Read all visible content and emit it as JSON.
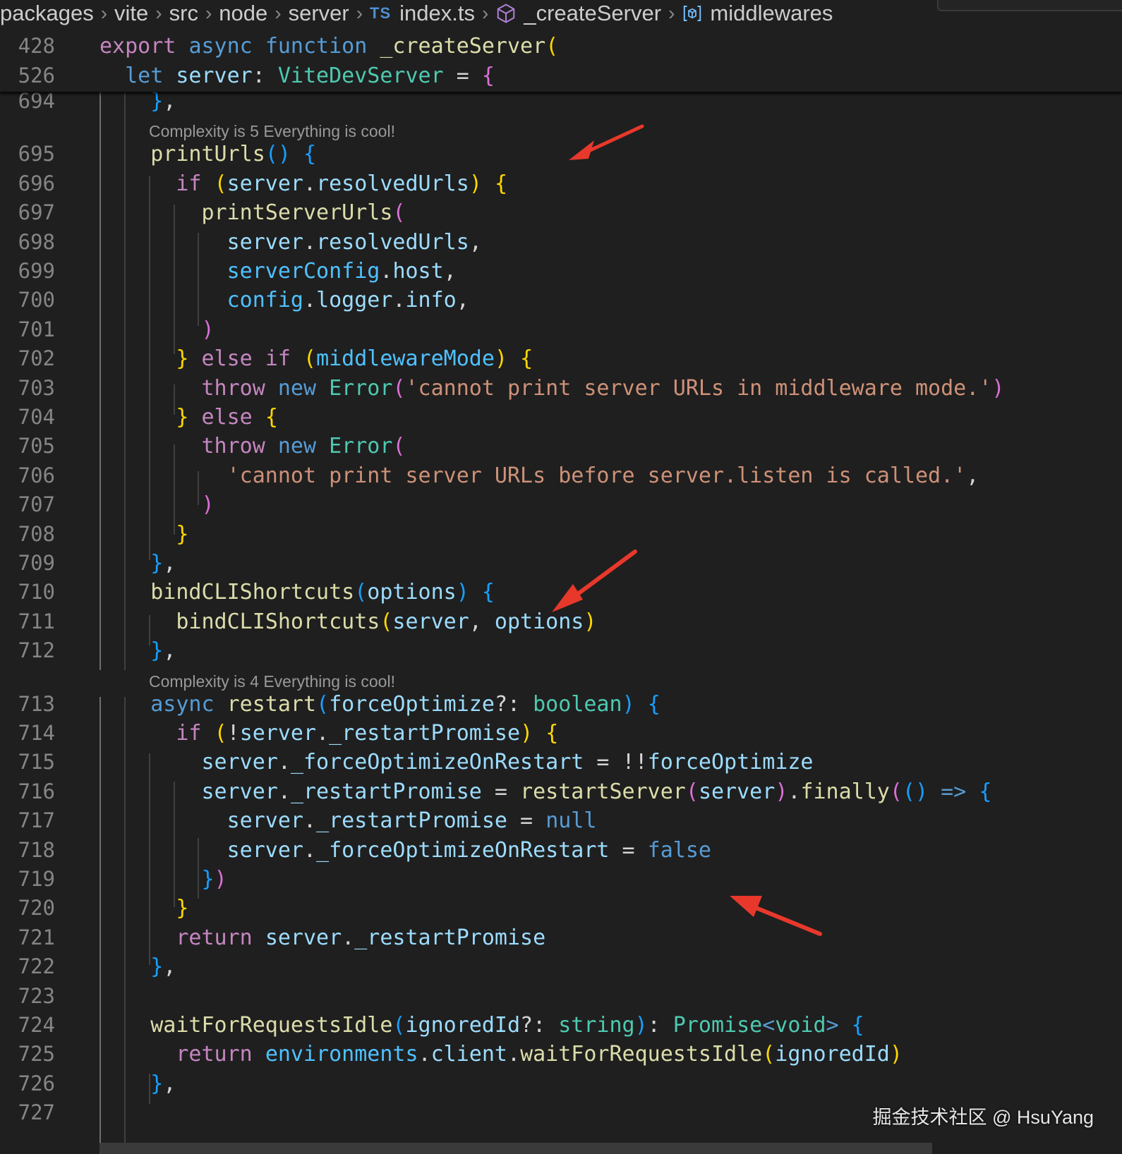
{
  "breadcrumb": [
    {
      "label": "packages",
      "icon": ""
    },
    {
      "label": "vite",
      "icon": ""
    },
    {
      "label": "src",
      "icon": ""
    },
    {
      "label": "node",
      "icon": ""
    },
    {
      "label": "server",
      "icon": ""
    },
    {
      "label": "index.ts",
      "icon": "typescript-file-icon",
      "badge": "TS"
    },
    {
      "label": "_createServer",
      "icon": "symbol-method-icon"
    },
    {
      "label": "middlewares",
      "icon": "symbol-variable-icon"
    }
  ],
  "sticky_lines": [
    {
      "n": "428",
      "t": [
        [
          "export",
          "ctl"
        ],
        [
          " ",
          "pl"
        ],
        [
          "async",
          "kw"
        ],
        [
          " ",
          "pl"
        ],
        [
          "function",
          "kw"
        ],
        [
          " ",
          "pl"
        ],
        [
          "_createServer",
          "fn"
        ],
        [
          "(",
          "b1"
        ]
      ]
    },
    {
      "n": "526",
      "t": [
        [
          "  ",
          "pl"
        ],
        [
          "let",
          "kw"
        ],
        [
          " ",
          "pl"
        ],
        [
          "server",
          "var"
        ],
        [
          ": ",
          "pl"
        ],
        [
          "ViteDevServer",
          "ty"
        ],
        [
          " = ",
          "pl"
        ],
        [
          "{",
          "b2"
        ]
      ]
    }
  ],
  "code_lines": [
    {
      "n": "694",
      "t": [
        [
          "    ",
          "pl"
        ],
        [
          "}",
          "b3"
        ],
        [
          ",",
          "pl"
        ]
      ]
    },
    {
      "lens": "Complexity is 5 Everything is cool!"
    },
    {
      "n": "695",
      "t": [
        [
          "    ",
          "pl"
        ],
        [
          "printUrls",
          "fn"
        ],
        [
          "()",
          "b3"
        ],
        [
          " ",
          "pl"
        ],
        [
          "{",
          "b3"
        ]
      ]
    },
    {
      "n": "696",
      "t": [
        [
          "      ",
          "pl"
        ],
        [
          "if",
          "ctl"
        ],
        [
          " ",
          "pl"
        ],
        [
          "(",
          "b1"
        ],
        [
          "server",
          "var"
        ],
        [
          ".",
          "pl"
        ],
        [
          "resolvedUrls",
          "var"
        ],
        [
          ")",
          "b1"
        ],
        [
          " ",
          "pl"
        ],
        [
          "{",
          "b1"
        ]
      ]
    },
    {
      "n": "697",
      "t": [
        [
          "        ",
          "pl"
        ],
        [
          "printServerUrls",
          "fn"
        ],
        [
          "(",
          "b2"
        ]
      ]
    },
    {
      "n": "698",
      "t": [
        [
          "          ",
          "pl"
        ],
        [
          "server",
          "var"
        ],
        [
          ".",
          "pl"
        ],
        [
          "resolvedUrls",
          "var"
        ],
        [
          ",",
          "pl"
        ]
      ]
    },
    {
      "n": "699",
      "t": [
        [
          "          ",
          "pl"
        ],
        [
          "serverConfig",
          "cst"
        ],
        [
          ".",
          "pl"
        ],
        [
          "host",
          "var"
        ],
        [
          ",",
          "pl"
        ]
      ]
    },
    {
      "n": "700",
      "t": [
        [
          "          ",
          "pl"
        ],
        [
          "config",
          "cst"
        ],
        [
          ".",
          "pl"
        ],
        [
          "logger",
          "var"
        ],
        [
          ".",
          "pl"
        ],
        [
          "info",
          "var"
        ],
        [
          ",",
          "pl"
        ]
      ]
    },
    {
      "n": "701",
      "t": [
        [
          "        ",
          "pl"
        ],
        [
          ")",
          "b2"
        ]
      ]
    },
    {
      "n": "702",
      "t": [
        [
          "      ",
          "pl"
        ],
        [
          "}",
          "b1"
        ],
        [
          " ",
          "pl"
        ],
        [
          "else",
          "ctl"
        ],
        [
          " ",
          "pl"
        ],
        [
          "if",
          "ctl"
        ],
        [
          " ",
          "pl"
        ],
        [
          "(",
          "b1"
        ],
        [
          "middlewareMode",
          "cst"
        ],
        [
          ")",
          "b1"
        ],
        [
          " ",
          "pl"
        ],
        [
          "{",
          "b1"
        ]
      ]
    },
    {
      "n": "703",
      "t": [
        [
          "        ",
          "pl"
        ],
        [
          "throw",
          "ctl"
        ],
        [
          " ",
          "pl"
        ],
        [
          "new",
          "kw"
        ],
        [
          " ",
          "pl"
        ],
        [
          "Error",
          "ty"
        ],
        [
          "(",
          "b2"
        ],
        [
          "'cannot print server URLs in middleware mode.'",
          "str"
        ],
        [
          ")",
          "b2"
        ]
      ]
    },
    {
      "n": "704",
      "t": [
        [
          "      ",
          "pl"
        ],
        [
          "}",
          "b1"
        ],
        [
          " ",
          "pl"
        ],
        [
          "else",
          "ctl"
        ],
        [
          " ",
          "pl"
        ],
        [
          "{",
          "b1"
        ]
      ]
    },
    {
      "n": "705",
      "t": [
        [
          "        ",
          "pl"
        ],
        [
          "throw",
          "ctl"
        ],
        [
          " ",
          "pl"
        ],
        [
          "new",
          "kw"
        ],
        [
          " ",
          "pl"
        ],
        [
          "Error",
          "ty"
        ],
        [
          "(",
          "b2"
        ]
      ]
    },
    {
      "n": "706",
      "t": [
        [
          "          ",
          "pl"
        ],
        [
          "'cannot print server URLs before server.listen is called.'",
          "str"
        ],
        [
          ",",
          "pl"
        ]
      ]
    },
    {
      "n": "707",
      "t": [
        [
          "        ",
          "pl"
        ],
        [
          ")",
          "b2"
        ]
      ]
    },
    {
      "n": "708",
      "t": [
        [
          "      ",
          "pl"
        ],
        [
          "}",
          "b1"
        ]
      ]
    },
    {
      "n": "709",
      "t": [
        [
          "    ",
          "pl"
        ],
        [
          "}",
          "b3"
        ],
        [
          ",",
          "pl"
        ]
      ]
    },
    {
      "n": "710",
      "t": [
        [
          "    ",
          "pl"
        ],
        [
          "bindCLIShortcuts",
          "fn"
        ],
        [
          "(",
          "b3"
        ],
        [
          "options",
          "var"
        ],
        [
          ")",
          "b3"
        ],
        [
          " ",
          "pl"
        ],
        [
          "{",
          "b3"
        ]
      ]
    },
    {
      "n": "711",
      "t": [
        [
          "      ",
          "pl"
        ],
        [
          "bindCLIShortcuts",
          "fn"
        ],
        [
          "(",
          "b1"
        ],
        [
          "server",
          "var"
        ],
        [
          ", ",
          "pl"
        ],
        [
          "options",
          "var"
        ],
        [
          ")",
          "b1"
        ]
      ]
    },
    {
      "n": "712",
      "t": [
        [
          "    ",
          "pl"
        ],
        [
          "}",
          "b3"
        ],
        [
          ",",
          "pl"
        ]
      ]
    },
    {
      "lens": "Complexity is 4 Everything is cool!"
    },
    {
      "n": "713",
      "t": [
        [
          "    ",
          "pl"
        ],
        [
          "async",
          "kw"
        ],
        [
          " ",
          "pl"
        ],
        [
          "restart",
          "fn"
        ],
        [
          "(",
          "b3"
        ],
        [
          "forceOptimize",
          "var"
        ],
        [
          "?: ",
          "pl"
        ],
        [
          "boolean",
          "ty"
        ],
        [
          ")",
          "b3"
        ],
        [
          " ",
          "pl"
        ],
        [
          "{",
          "b3"
        ]
      ]
    },
    {
      "n": "714",
      "t": [
        [
          "      ",
          "pl"
        ],
        [
          "if",
          "ctl"
        ],
        [
          " ",
          "pl"
        ],
        [
          "(",
          "b1"
        ],
        [
          "!",
          "pl"
        ],
        [
          "server",
          "var"
        ],
        [
          ".",
          "pl"
        ],
        [
          "_restartPromise",
          "var"
        ],
        [
          ")",
          "b1"
        ],
        [
          " ",
          "pl"
        ],
        [
          "{",
          "b1"
        ]
      ]
    },
    {
      "n": "715",
      "t": [
        [
          "        ",
          "pl"
        ],
        [
          "server",
          "var"
        ],
        [
          ".",
          "pl"
        ],
        [
          "_forceOptimizeOnRestart",
          "var"
        ],
        [
          " = !!",
          "pl"
        ],
        [
          "forceOptimize",
          "var"
        ]
      ]
    },
    {
      "n": "716",
      "t": [
        [
          "        ",
          "pl"
        ],
        [
          "server",
          "var"
        ],
        [
          ".",
          "pl"
        ],
        [
          "_restartPromise",
          "var"
        ],
        [
          " = ",
          "pl"
        ],
        [
          "restartServer",
          "fn"
        ],
        [
          "(",
          "b2"
        ],
        [
          "server",
          "var"
        ],
        [
          ")",
          "b2"
        ],
        [
          ".",
          "pl"
        ],
        [
          "finally",
          "fn"
        ],
        [
          "(",
          "b2"
        ],
        [
          "()",
          "b3"
        ],
        [
          " ",
          "pl"
        ],
        [
          "=>",
          "kw"
        ],
        [
          " ",
          "pl"
        ],
        [
          "{",
          "b3"
        ]
      ]
    },
    {
      "n": "717",
      "t": [
        [
          "          ",
          "pl"
        ],
        [
          "server",
          "var"
        ],
        [
          ".",
          "pl"
        ],
        [
          "_restartPromise",
          "var"
        ],
        [
          " = ",
          "pl"
        ],
        [
          "null",
          "kw"
        ]
      ]
    },
    {
      "n": "718",
      "t": [
        [
          "          ",
          "pl"
        ],
        [
          "server",
          "var"
        ],
        [
          ".",
          "pl"
        ],
        [
          "_forceOptimizeOnRestart",
          "var"
        ],
        [
          " = ",
          "pl"
        ],
        [
          "false",
          "kw"
        ]
      ]
    },
    {
      "n": "719",
      "t": [
        [
          "        ",
          "pl"
        ],
        [
          "}",
          "b3"
        ],
        [
          ")",
          "b2"
        ]
      ]
    },
    {
      "n": "720",
      "t": [
        [
          "      ",
          "pl"
        ],
        [
          "}",
          "b1"
        ]
      ]
    },
    {
      "n": "721",
      "t": [
        [
          "      ",
          "pl"
        ],
        [
          "return",
          "ctl"
        ],
        [
          " ",
          "pl"
        ],
        [
          "server",
          "var"
        ],
        [
          ".",
          "pl"
        ],
        [
          "_restartPromise",
          "var"
        ]
      ]
    },
    {
      "n": "722",
      "t": [
        [
          "    ",
          "pl"
        ],
        [
          "}",
          "b3"
        ],
        [
          ",",
          "pl"
        ]
      ]
    },
    {
      "n": "723",
      "t": []
    },
    {
      "n": "724",
      "t": [
        [
          "    ",
          "pl"
        ],
        [
          "waitForRequestsIdle",
          "fn"
        ],
        [
          "(",
          "b3"
        ],
        [
          "ignoredId",
          "var"
        ],
        [
          "?: ",
          "pl"
        ],
        [
          "string",
          "ty"
        ],
        [
          ")",
          "b3"
        ],
        [
          ": ",
          "pl"
        ],
        [
          "Promise",
          "ty"
        ],
        [
          "<",
          "kw"
        ],
        [
          "void",
          "ty"
        ],
        [
          ">",
          "kw"
        ],
        [
          " ",
          "pl"
        ],
        [
          "{",
          "b3"
        ]
      ]
    },
    {
      "n": "725",
      "t": [
        [
          "      ",
          "pl"
        ],
        [
          "return",
          "ctl"
        ],
        [
          " ",
          "pl"
        ],
        [
          "environments",
          "cst"
        ],
        [
          ".",
          "pl"
        ],
        [
          "client",
          "var"
        ],
        [
          ".",
          "pl"
        ],
        [
          "waitForRequestsIdle",
          "fn"
        ],
        [
          "(",
          "b1"
        ],
        [
          "ignoredId",
          "var"
        ],
        [
          ")",
          "b1"
        ]
      ]
    },
    {
      "n": "726",
      "t": [
        [
          "    ",
          "pl"
        ],
        [
          "}",
          "b3"
        ],
        [
          ",",
          "pl"
        ]
      ]
    },
    {
      "n": "727",
      "t": []
    }
  ],
  "colors": {
    "background": "#1f1f1f",
    "line_number": "#858585",
    "annotation_arrow": "#e8382b"
  },
  "watermark": "掘金技术社区 @ HsuYang"
}
